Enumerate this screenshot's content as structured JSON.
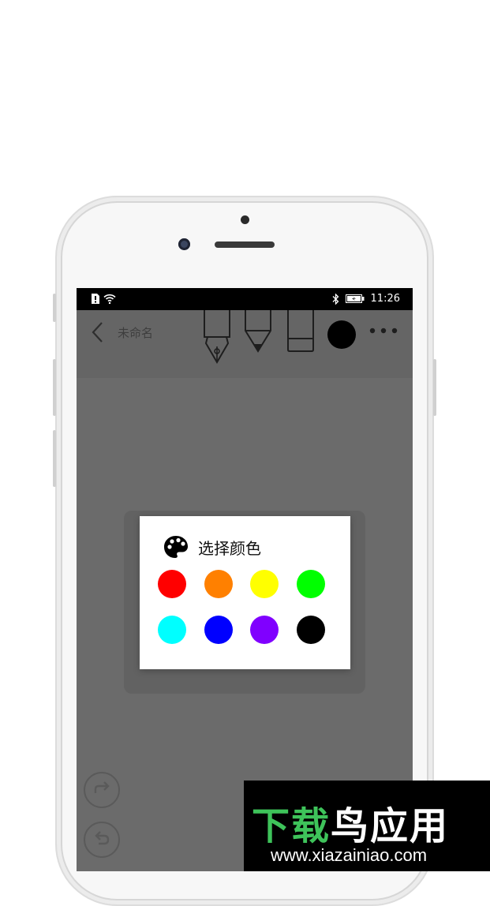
{
  "status_bar": {
    "time": "11:26",
    "icons": [
      "sim-alert-icon",
      "wifi-icon",
      "bluetooth-icon",
      "battery-charging-icon"
    ]
  },
  "toolbar": {
    "title": "未命名",
    "tools": [
      "fountain-pen-icon",
      "pencil-icon",
      "eraser-icon"
    ],
    "current_color": "#000000"
  },
  "color_dialog": {
    "title": "选择颜色",
    "colors": [
      "#ff0000",
      "#ff8000",
      "#ffff00",
      "#00ff00",
      "#00ffff",
      "#0000ff",
      "#8000ff",
      "#000000"
    ]
  },
  "watermark": {
    "title_green": "下载",
    "title_white": "鸟应用",
    "url": "www.xiazainiao.com"
  }
}
